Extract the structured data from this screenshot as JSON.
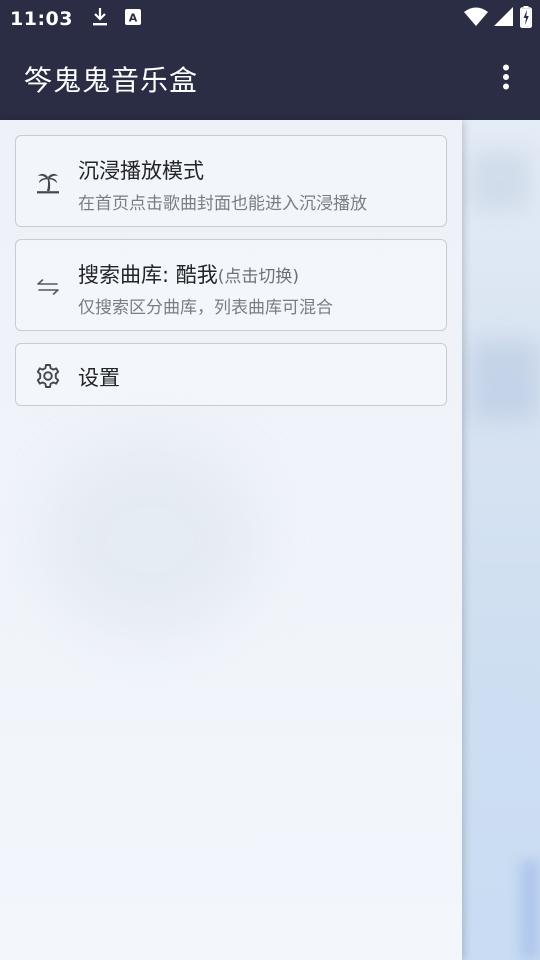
{
  "status_bar": {
    "time": "11:03",
    "left_icons": [
      "download-icon",
      "text-box-icon"
    ],
    "right_icons": [
      "wifi-icon",
      "cellular-signal-icon",
      "battery-charging-icon"
    ]
  },
  "app_bar": {
    "title": "笒鬼鬼音乐盒",
    "overflow_icon": "more-vertical-icon"
  },
  "drawer": {
    "items": [
      {
        "icon": "palm-tree-icon",
        "title": "沉浸播放模式",
        "subtitle": "在首页点击歌曲封面也能进入沉浸播放"
      },
      {
        "icon": "swap-arrows-icon",
        "title": "搜索曲库: 酷我",
        "title_hint": "(点击切换)",
        "subtitle": "仅搜索区分曲库，列表曲库可混合"
      },
      {
        "icon": "gear-icon",
        "title": "设置"
      }
    ]
  },
  "colors": {
    "app_bar": "#2a2d44",
    "drawer_bg": "#f0f4fa",
    "card_border": "#c9ccd3",
    "title_text": "#222428",
    "subtitle_text": "#7a7d84"
  }
}
